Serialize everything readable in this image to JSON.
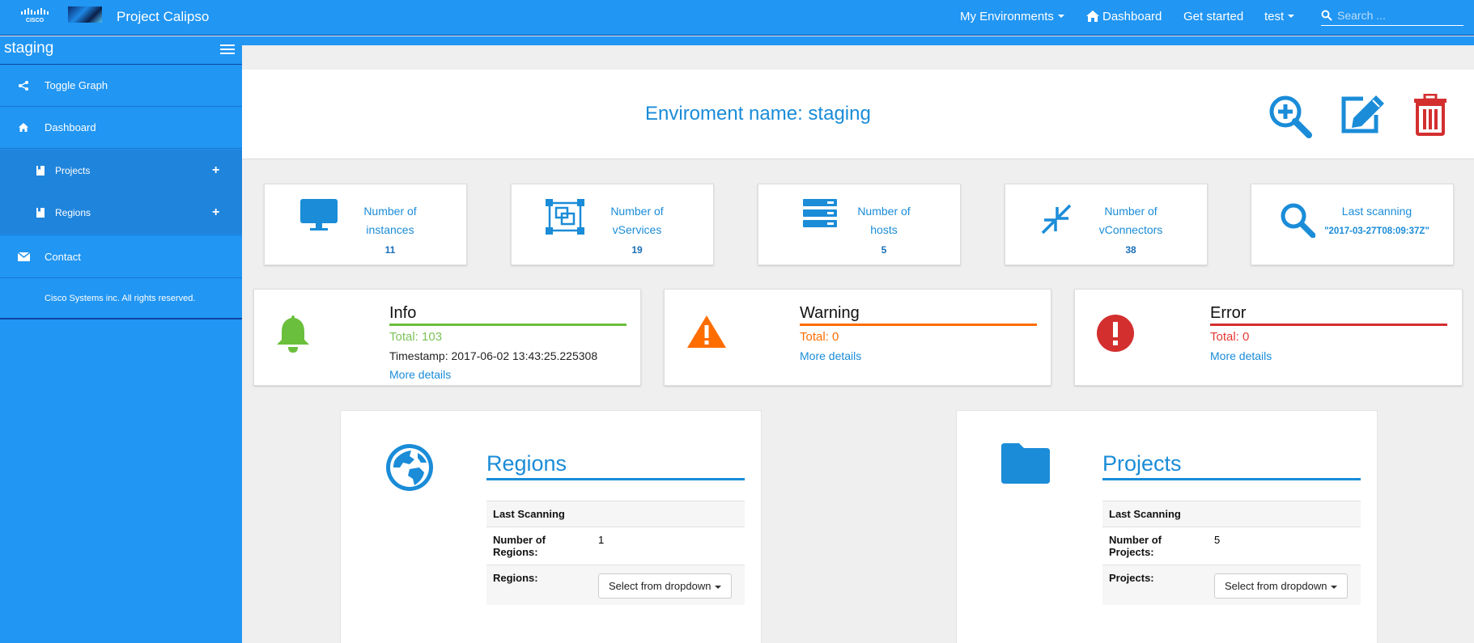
{
  "navbar": {
    "brand_title": "Project Calipso",
    "environments_label": "My Environments",
    "dashboard_label": "Dashboard",
    "get_started_label": "Get started",
    "user_label": "test",
    "search_placeholder": "Search ...",
    "brand_color": "#2196f3"
  },
  "sidebar": {
    "environment_name": "staging",
    "items": [
      {
        "label": "Toggle Graph",
        "icon": "share-icon"
      },
      {
        "label": "Dashboard",
        "icon": "home-icon"
      },
      {
        "label": "Projects",
        "icon": "bookmark-icon"
      },
      {
        "label": "Regions",
        "icon": "bookmark-icon"
      },
      {
        "label": "Contact",
        "icon": "envelope-icon"
      }
    ],
    "copyright": "Cisco Systems inc. All rights reserved."
  },
  "header": {
    "title": "Enviroment name: staging"
  },
  "stats": [
    {
      "label_line1": "Number of",
      "label_line2": "instances",
      "value": "11",
      "icon": "monitor-icon"
    },
    {
      "label_line1": "Number of",
      "label_line2": "vServices",
      "value": "19",
      "icon": "vservices-icon"
    },
    {
      "label_line1": "Number of",
      "label_line2": "hosts",
      "value": "5",
      "icon": "server-icon"
    },
    {
      "label_line1": "Number of",
      "label_line2": "vConnectors",
      "value": "38",
      "icon": "compress-icon"
    },
    {
      "label_line1": "Last scanning",
      "label_line2": "\"2017-03-27T08:09:37Z\"",
      "icon": "magnifier-icon"
    }
  ],
  "alerts": {
    "info": {
      "title": "Info",
      "total": "Total: 103",
      "timestamp": "Timestamp: 2017-06-02 13:43:25.225308",
      "more": "More details",
      "color": "#8bc34a"
    },
    "warning": {
      "title": "Warning",
      "total": "Total: 0",
      "more": "More details",
      "color": "#ff6d00"
    },
    "error": {
      "title": "Error",
      "total": "Total: 0",
      "more": "More details",
      "color": "#d32f2f"
    }
  },
  "regions": {
    "title": "Regions",
    "last_scanning_label": "Last Scanning",
    "count_label": "Number of Regions:",
    "count_value": "1",
    "select_label": "Regions:",
    "dropdown_label": "Select from dropdown"
  },
  "projects": {
    "title": "Projects",
    "last_scanning_label": "Last Scanning",
    "count_label": "Number of Projects:",
    "count_value": "5",
    "select_label": "Projects:",
    "dropdown_label": "Select from dropdown"
  }
}
